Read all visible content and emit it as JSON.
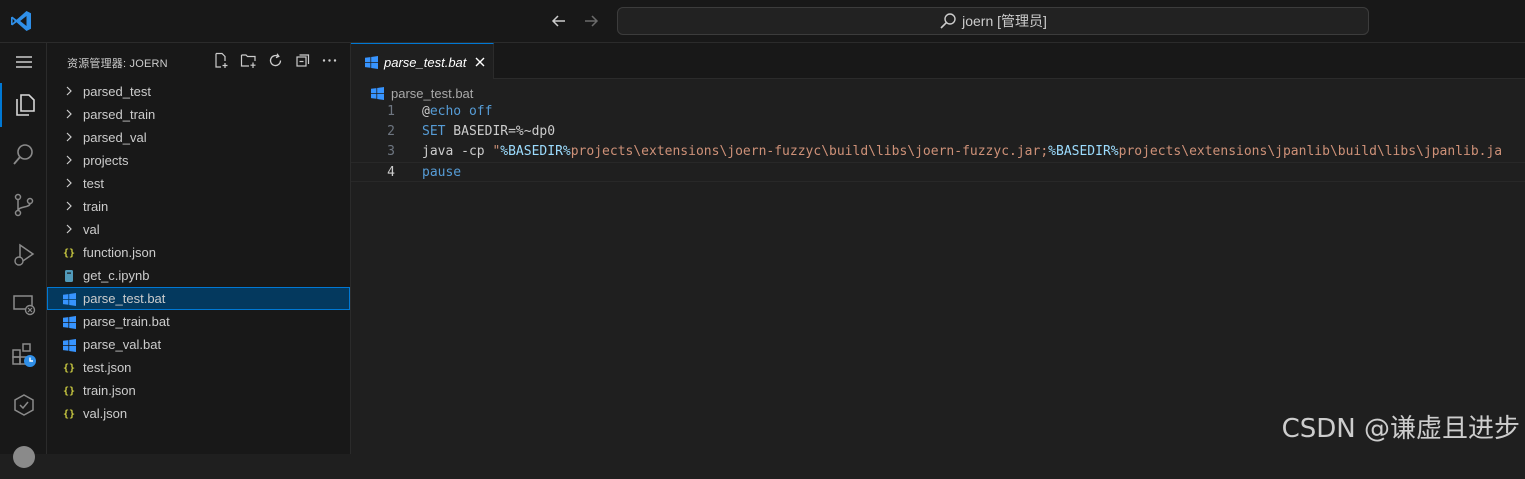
{
  "titlebar": {
    "search_text": "joern [管理员]"
  },
  "sidebar": {
    "title": "资源管理器: JOERN",
    "items": [
      {
        "label": "parsed_test",
        "kind": "folder"
      },
      {
        "label": "parsed_train",
        "kind": "folder"
      },
      {
        "label": "parsed_val",
        "kind": "folder"
      },
      {
        "label": "projects",
        "kind": "folder"
      },
      {
        "label": "test",
        "kind": "folder"
      },
      {
        "label": "train",
        "kind": "folder"
      },
      {
        "label": "val",
        "kind": "folder"
      },
      {
        "label": "function.json",
        "kind": "json"
      },
      {
        "label": "get_c.ipynb",
        "kind": "notebook"
      },
      {
        "label": "parse_test.bat",
        "kind": "bat",
        "selected": true
      },
      {
        "label": "parse_train.bat",
        "kind": "bat"
      },
      {
        "label": "parse_val.bat",
        "kind": "bat"
      },
      {
        "label": "test.json",
        "kind": "json"
      },
      {
        "label": "train.json",
        "kind": "json"
      },
      {
        "label": "val.json",
        "kind": "json"
      }
    ]
  },
  "editor": {
    "tab_label": "parse_test.bat",
    "breadcrumb": "parse_test.bat",
    "lines": [
      {
        "n": "1"
      },
      {
        "n": "2"
      },
      {
        "n": "3"
      },
      {
        "n": "4",
        "active": true
      }
    ],
    "code": {
      "l1_at": "@",
      "l1_kw": "echo off",
      "l2_kw": "SET",
      "l2_rest": " BASEDIR=%~dp0",
      "l3_a": "java -cp ",
      "l3_q": "\"",
      "l3_v1": "%BASEDIR%",
      "l3_s1": "projects\\extensions\\joern-fuzzyc\\build\\libs\\joern-fuzzyc.jar;",
      "l3_v2": "%BASEDIR%",
      "l3_s2": "projects\\extensions\\jpanlib\\build\\libs\\jpanlib.ja",
      "l4_kw": "pause"
    }
  },
  "watermark": "CSDN @谦虚且进步",
  "colors": {
    "accent": "#0078d4",
    "bat_icon": "#3794ff",
    "json_icon": "#cbcb41",
    "keyword": "#569cd6",
    "string": "#ce9178"
  }
}
